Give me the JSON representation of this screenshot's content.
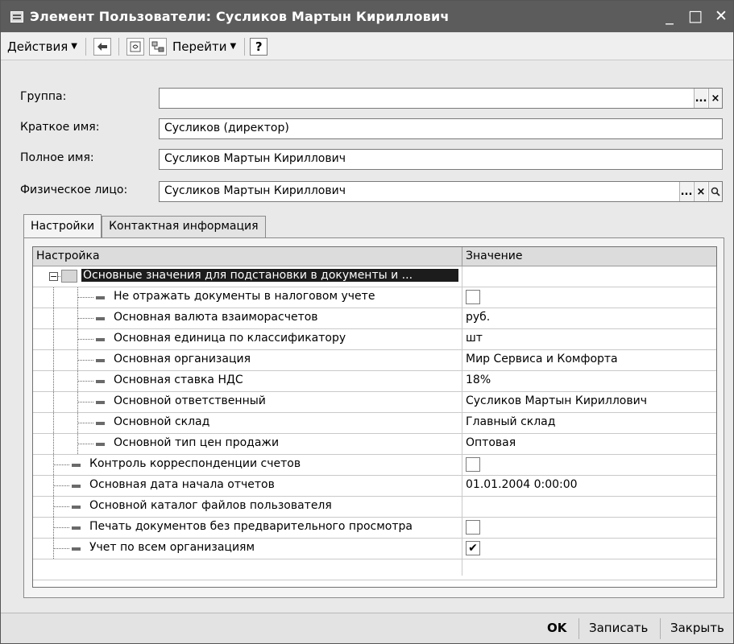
{
  "window": {
    "title": "Элемент Пользователи: Сусликов Мартын Кириллович",
    "controls": {
      "minimize": "_",
      "maximize": "□",
      "close": "✕"
    }
  },
  "toolbar": {
    "actions_label": "Действия",
    "goto_label": "Перейти",
    "help_label": "?"
  },
  "fields": [
    {
      "label": "Группа:",
      "value": ""
    },
    {
      "label": "Краткое имя:",
      "value": "Сусликов (директор)"
    },
    {
      "label": "Полное имя:",
      "value": "Сусликов Мартын Кириллович"
    },
    {
      "label": "Физическое лицо:",
      "value": "Сусликов Мартын Кириллович"
    }
  ],
  "field_buttons": {
    "select": "...",
    "clear": "×",
    "open": "🔍"
  },
  "tabs": [
    {
      "label": "Настройки",
      "active": true
    },
    {
      "label": "Контактная информация",
      "active": false
    }
  ],
  "table": {
    "columns": [
      "Настройка",
      "Значение"
    ],
    "group": {
      "label": "Основные значения для подстановки в документы и ..."
    },
    "rows": [
      {
        "name": "Не отражать документы в налоговом учете",
        "value": "",
        "checkbox": true,
        "checked": false
      },
      {
        "name": "Основная валюта взаиморасчетов",
        "value": "руб."
      },
      {
        "name": "Основная единица по классификатору",
        "value": "шт"
      },
      {
        "name": "Основная организация",
        "value": "Мир Сервиса и Комфорта"
      },
      {
        "name": "Основная ставка НДС",
        "value": "18%"
      },
      {
        "name": "Основной ответственный",
        "value": "Сусликов Мартын Кириллович"
      },
      {
        "name": "Основной склад",
        "value": "Главный склад"
      },
      {
        "name": "Основной тип цен продажи",
        "value": "Оптовая"
      },
      {
        "name": "Контроль корреспонденции счетов",
        "value": "",
        "checkbox": true,
        "checked": false
      },
      {
        "name": "Основная дата начала отчетов",
        "value": "01.01.2004 0:00:00"
      },
      {
        "name": "Основной каталог файлов пользователя",
        "value": ""
      },
      {
        "name": "Печать документов без предварительного просмотра",
        "value": "",
        "checkbox": true,
        "checked": false
      },
      {
        "name": "Учет по всем организациям",
        "value": "✔",
        "checkbox": true,
        "checked": true
      }
    ]
  },
  "footer": {
    "ok_label": "OK",
    "save_label": "Записать",
    "close_label": "Закрыть"
  }
}
